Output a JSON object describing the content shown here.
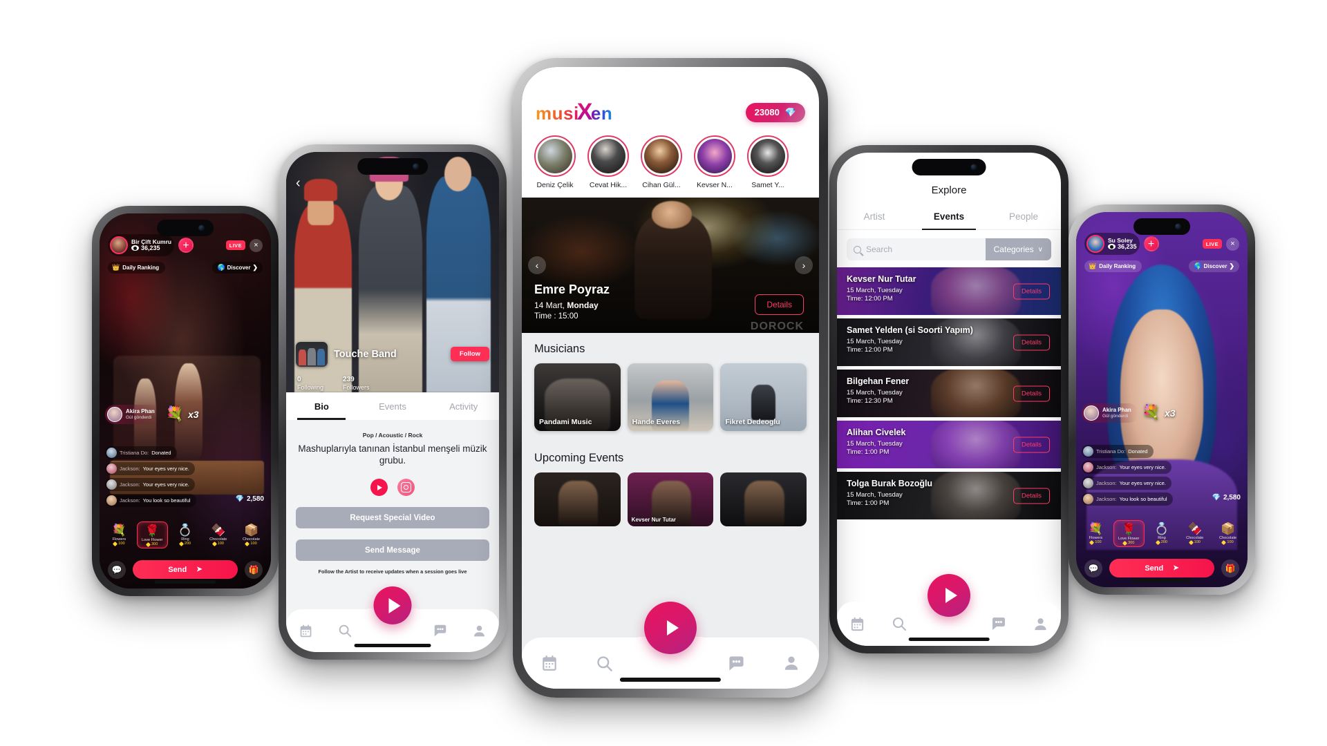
{
  "brand": {
    "accent": "#ff2e55",
    "logo_part1": "musi",
    "logo_x": "X",
    "logo_part2": "en"
  },
  "live_left": {
    "host_name": "Bir Çift Kumru",
    "viewers": "36,235",
    "add_label": "+",
    "live_label": "LIVE",
    "close_label": "×",
    "ranking_label": "Daily Ranking",
    "crown_icon": "👑",
    "discover_label": "Discover",
    "discover_icon": "🌎",
    "chevron": "❯",
    "gift_event": {
      "user": "Akira Phan",
      "action": "Gül gönderdi",
      "emoji": "💐",
      "multiplier": "x3"
    },
    "chat": [
      {
        "user": "Tristiana Do:",
        "msg": "Donated"
      },
      {
        "user": "Jackson:",
        "msg": "Your eyes very nice."
      },
      {
        "user": "Jackson:",
        "msg": "Your eyes very nice."
      },
      {
        "user": "Jackson:",
        "msg": "You look so beautiful"
      }
    ],
    "coin_icon": "💎",
    "coin_value": "2,580",
    "gifts": [
      {
        "name": "Flowers",
        "price": "100",
        "emoji": "💐",
        "selected": false
      },
      {
        "name": "Love Flower",
        "price": "300",
        "emoji": "🌹",
        "selected": true
      },
      {
        "name": "Ring",
        "price": "200",
        "emoji": "💍",
        "selected": false
      },
      {
        "name": "Chocolate",
        "price": "100",
        "emoji": "🍫",
        "selected": false
      },
      {
        "name": "Chocolate",
        "price": "100",
        "emoji": "📦",
        "selected": false
      }
    ],
    "chat_icon": "💬",
    "send_label": "Send",
    "send_arrow": "➤",
    "gift_icon": "🎁"
  },
  "live_right": {
    "host_name": "Su Soley",
    "viewers": "36,235",
    "add_label": "+",
    "live_label": "LIVE",
    "close_label": "×",
    "ranking_label": "Daily Ranking",
    "crown_icon": "👑",
    "discover_label": "Discover",
    "discover_icon": "🌎",
    "chevron": "❯",
    "gift_event": {
      "user": "Akira Phan",
      "action": "Gül gönderdi",
      "emoji": "💐",
      "multiplier": "x3"
    },
    "chat": [
      {
        "user": "Tristiana Do:",
        "msg": "Donated"
      },
      {
        "user": "Jackson:",
        "msg": "Your eyes very nice."
      },
      {
        "user": "Jackson:",
        "msg": "Your eyes very nice."
      },
      {
        "user": "Jackson:",
        "msg": "You look so beautiful"
      }
    ],
    "coin_icon": "💎",
    "coin_value": "2,580",
    "gifts": [
      {
        "name": "Flowers",
        "price": "100",
        "emoji": "💐",
        "selected": false
      },
      {
        "name": "Love Flower",
        "price": "300",
        "emoji": "🌹",
        "selected": true
      },
      {
        "name": "Ring",
        "price": "200",
        "emoji": "💍",
        "selected": false
      },
      {
        "name": "Chocolate",
        "price": "100",
        "emoji": "🍫",
        "selected": false
      },
      {
        "name": "Chocolate",
        "price": "100",
        "emoji": "📦",
        "selected": false
      }
    ],
    "chat_icon": "💬",
    "send_label": "Send",
    "send_arrow": "➤",
    "gift_icon": "🎁"
  },
  "profile": {
    "back_icon": "‹",
    "name": "Touche Band",
    "follow_label": "Follow",
    "following_count": "0",
    "following_label": "Following",
    "followers_count": "239",
    "followers_label": "Followers",
    "tabs": [
      {
        "label": "Bio",
        "active": true
      },
      {
        "label": "Events",
        "active": false
      },
      {
        "label": "Activity",
        "active": false
      }
    ],
    "genres": "Pop / Acoustic / Rock",
    "bio": "Mashuplarıyla tanınan İstanbul menşeli müzik grubu.",
    "socials": [
      "youtube-icon",
      "instagram-icon"
    ],
    "request_video_label": "Request Special Video",
    "send_message_label": "Send Message",
    "note": "Follow the Artist to receive updates when a session goes live"
  },
  "home": {
    "gem_value": "23080",
    "gem_icon": "💎",
    "stories": [
      {
        "name": "Deniz Çelik"
      },
      {
        "name": "Cevat Hik..."
      },
      {
        "name": "Cihan Gül..."
      },
      {
        "name": "Kevser N..."
      },
      {
        "name": "Samet Y..."
      }
    ],
    "featured": {
      "prev_icon": "‹",
      "next_icon": "›",
      "title": "Emre Poyraz",
      "date_prefix": "14 Mart,",
      "date_day": "Monday",
      "time": "Time : 15:00",
      "details_label": "Details",
      "watermark": "DOROCK"
    },
    "musicians_title": "Musicians",
    "musicians": [
      {
        "name": "Pandami Music"
      },
      {
        "name": "Hande Everes"
      },
      {
        "name": "Fikret Dedeoglu"
      }
    ],
    "upcoming_title": "Upcoming Events",
    "upcoming": [
      {
        "caption": ""
      },
      {
        "caption": "Kevser Nur Tutar"
      },
      {
        "caption": ""
      }
    ]
  },
  "explore": {
    "title": "Explore",
    "tabs": [
      {
        "label": "Artist",
        "active": false
      },
      {
        "label": "Events",
        "active": true
      },
      {
        "label": "People",
        "active": false
      }
    ],
    "search_placeholder": "Search",
    "search_value": "",
    "categories_label": "Categories",
    "categories_chevron": "∨",
    "events": [
      {
        "name": "Kevser Nur Tutar",
        "date": "15 March, Tuesday",
        "time": "Time: 12:00 PM",
        "details_label": "Details"
      },
      {
        "name": "Samet Yelden (si Soorti Yapım)",
        "date": "15 March, Tuesday",
        "time": "Time: 12:00 PM",
        "details_label": "Details"
      },
      {
        "name": "Bilgehan Fener",
        "date": "15 March, Tuesday",
        "time": "Time: 12:30 PM",
        "details_label": "Details"
      },
      {
        "name": "Alihan Civelek",
        "date": "15 March, Tuesday",
        "time": "Time: 1:00 PM",
        "details_label": "Details"
      },
      {
        "name": "Tolga Burak Bozoğlu",
        "date": "15 March, Tuesday",
        "time": "Time: 1:00 PM",
        "details_label": "Details"
      }
    ]
  },
  "tabbar": {
    "items": [
      {
        "icon": "calendar-icon"
      },
      {
        "icon": "search-icon"
      },
      {
        "icon": "play-fab-icon"
      },
      {
        "icon": "chat-icon"
      },
      {
        "icon": "profile-icon"
      }
    ]
  }
}
